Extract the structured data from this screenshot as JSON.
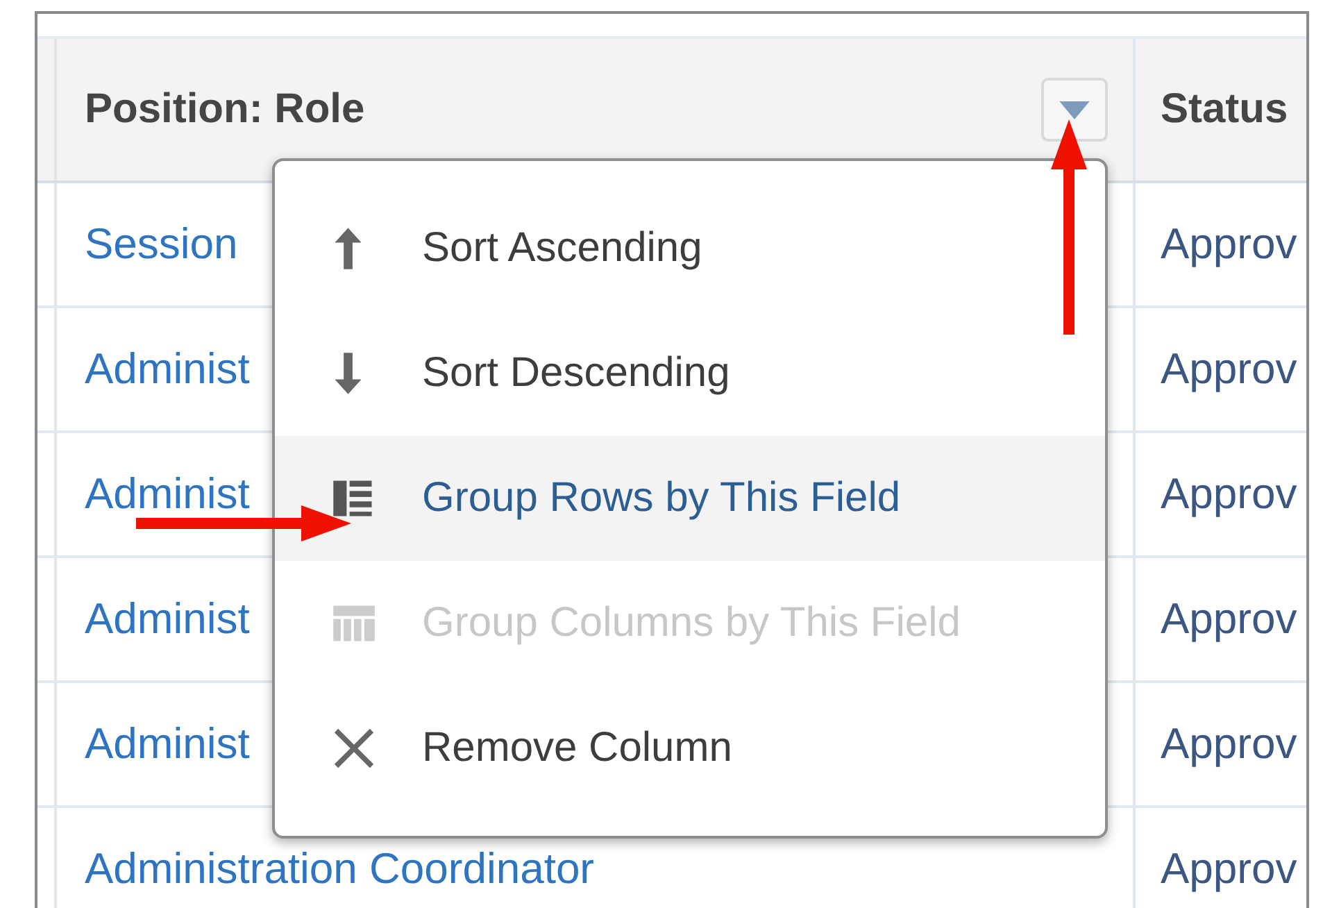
{
  "table": {
    "columns": [
      {
        "label": "Position: Role",
        "menu_button": true
      },
      {
        "label": "Status",
        "menu_button": false
      }
    ],
    "rows": [
      {
        "role": "Session",
        "status": "Approv"
      },
      {
        "role": "Administ",
        "status": "Approv"
      },
      {
        "role": "Administ",
        "status": "Approv"
      },
      {
        "role": "Administ",
        "status": "Approv"
      },
      {
        "role": "Administ",
        "status": "Approv"
      },
      {
        "role": "Administration Coordinator",
        "status": "Approv"
      }
    ]
  },
  "column_menu": {
    "items": [
      {
        "label": "Sort Ascending",
        "kind": "sort-up",
        "selected": false,
        "disabled": false
      },
      {
        "label": "Sort Descending",
        "kind": "sort-down",
        "selected": false,
        "disabled": false
      },
      {
        "label": "Group Rows by This Field",
        "kind": "group-rows",
        "selected": true,
        "disabled": false
      },
      {
        "label": "Group Columns by This Field",
        "kind": "group-columns",
        "selected": false,
        "disabled": true
      },
      {
        "label": "Remove Column",
        "kind": "remove",
        "selected": false,
        "disabled": false
      }
    ]
  }
}
